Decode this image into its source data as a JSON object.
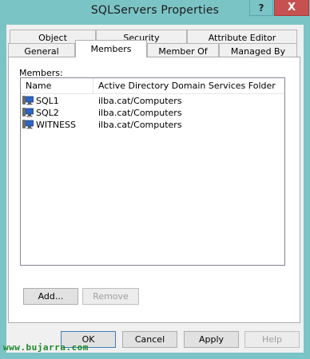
{
  "window": {
    "title": "SQLServers Properties",
    "help_glyph": "?",
    "close_glyph": "X"
  },
  "tabs": {
    "row1": [
      "Object",
      "Security",
      "Attribute Editor"
    ],
    "row2": [
      "General",
      "Members",
      "Member Of",
      "Managed By"
    ],
    "selected": "Members"
  },
  "members": {
    "label": "Members:",
    "columns": [
      "Name",
      "Active Directory Domain Services Folder"
    ],
    "rows": [
      {
        "name": "SQL1",
        "folder": "ilba.cat/Computers",
        "icon": "computer-icon"
      },
      {
        "name": "SQL2",
        "folder": "ilba.cat/Computers",
        "icon": "computer-icon"
      },
      {
        "name": "WITNESS",
        "folder": "ilba.cat/Computers",
        "icon": "computer-icon"
      }
    ],
    "add_label": "Add...",
    "remove_label": "Remove"
  },
  "footer": {
    "ok_label": "OK",
    "cancel_label": "Cancel",
    "apply_label": "Apply",
    "help_label": "Help"
  },
  "watermark": "www.bujarra.com",
  "colors": {
    "frame": "#7bc4c6",
    "close": "#c75050",
    "watermark": "#1e8a2a"
  }
}
